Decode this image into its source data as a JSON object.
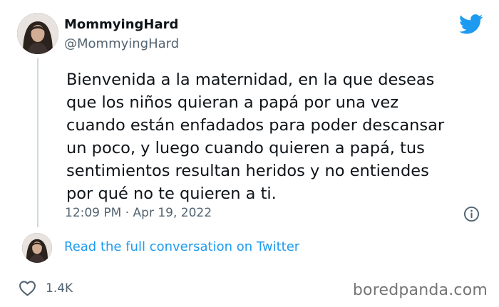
{
  "tweet": {
    "display_name": "MommyingHard",
    "handle": "@MommyingHard",
    "text_lines": [
      "Bienvenida a la maternidad, en la que deseas",
      "que los niños quieran a papá por una vez",
      "cuando están enfadados para poder descansar",
      "un poco, y luego cuando quieren a papá, tus",
      "sentimientos resultan heridos y no entiendes",
      "por qué no te quieren a ti."
    ],
    "timestamp": "12:09 PM · Apr 19, 2022",
    "read_more_label": "Read the full conversation on Twitter",
    "like_count": "1.4K"
  },
  "icons": {
    "brand": "twitter-bird-icon",
    "info": "info-icon",
    "like": "heart-icon"
  },
  "colors": {
    "twitter_blue": "#1d9bf0",
    "secondary_text": "#536471",
    "primary_text": "#0f1419",
    "thread_line": "#cfd9de"
  },
  "watermark": "boredpanda.com"
}
